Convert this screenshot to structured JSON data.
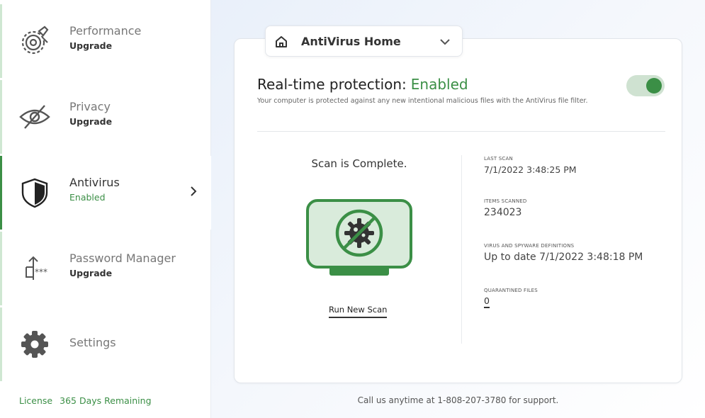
{
  "sidebar": {
    "items": [
      {
        "title": "Performance",
        "subtitle": "Upgrade",
        "icon": "performance-gear-icon"
      },
      {
        "title": "Privacy",
        "subtitle": "Upgrade",
        "icon": "eye-slash-icon"
      },
      {
        "title": "Antivirus",
        "subtitle": "Enabled",
        "icon": "shield-icon"
      },
      {
        "title": "Password Manager",
        "subtitle": "Upgrade",
        "icon": "password-key-icon"
      },
      {
        "title": "Settings",
        "subtitle": "",
        "icon": "gear-icon"
      }
    ],
    "license": {
      "label": "License",
      "value": "365 Days Remaining"
    }
  },
  "header": {
    "selector_label": "AntiVirus Home",
    "icons": [
      "home-icon",
      "chevron-down-icon"
    ]
  },
  "protection": {
    "label": "Real-time protection:",
    "status": "Enabled",
    "description": "Your computer is protected against any new intentional malicious files with the AntiVirus file filter.",
    "toggle_on": true
  },
  "scan": {
    "status": "Scan is Complete.",
    "run_label": "Run New Scan",
    "icon": "no-virus-monitor-icon"
  },
  "stats": {
    "last_scan_label": "LAST SCAN",
    "last_scan_value": "7/1/2022 3:48:25 PM",
    "items_scanned_label": "ITEMS SCANNED",
    "items_scanned_value": "234023",
    "definitions_label": "VIRUS AND SPYWARE DEFINITIONS",
    "definitions_value": "Up to date 7/1/2022 3:48:18 PM",
    "quarantined_label": "QUARANTINED FILES",
    "quarantined_value": "0"
  },
  "footer": {
    "support_text": "Call us anytime at 1-808-207-3780 for support."
  },
  "colors": {
    "accent": "#3b8f46",
    "accent_light": "#cfe2d1",
    "icon_gray": "#555555"
  }
}
